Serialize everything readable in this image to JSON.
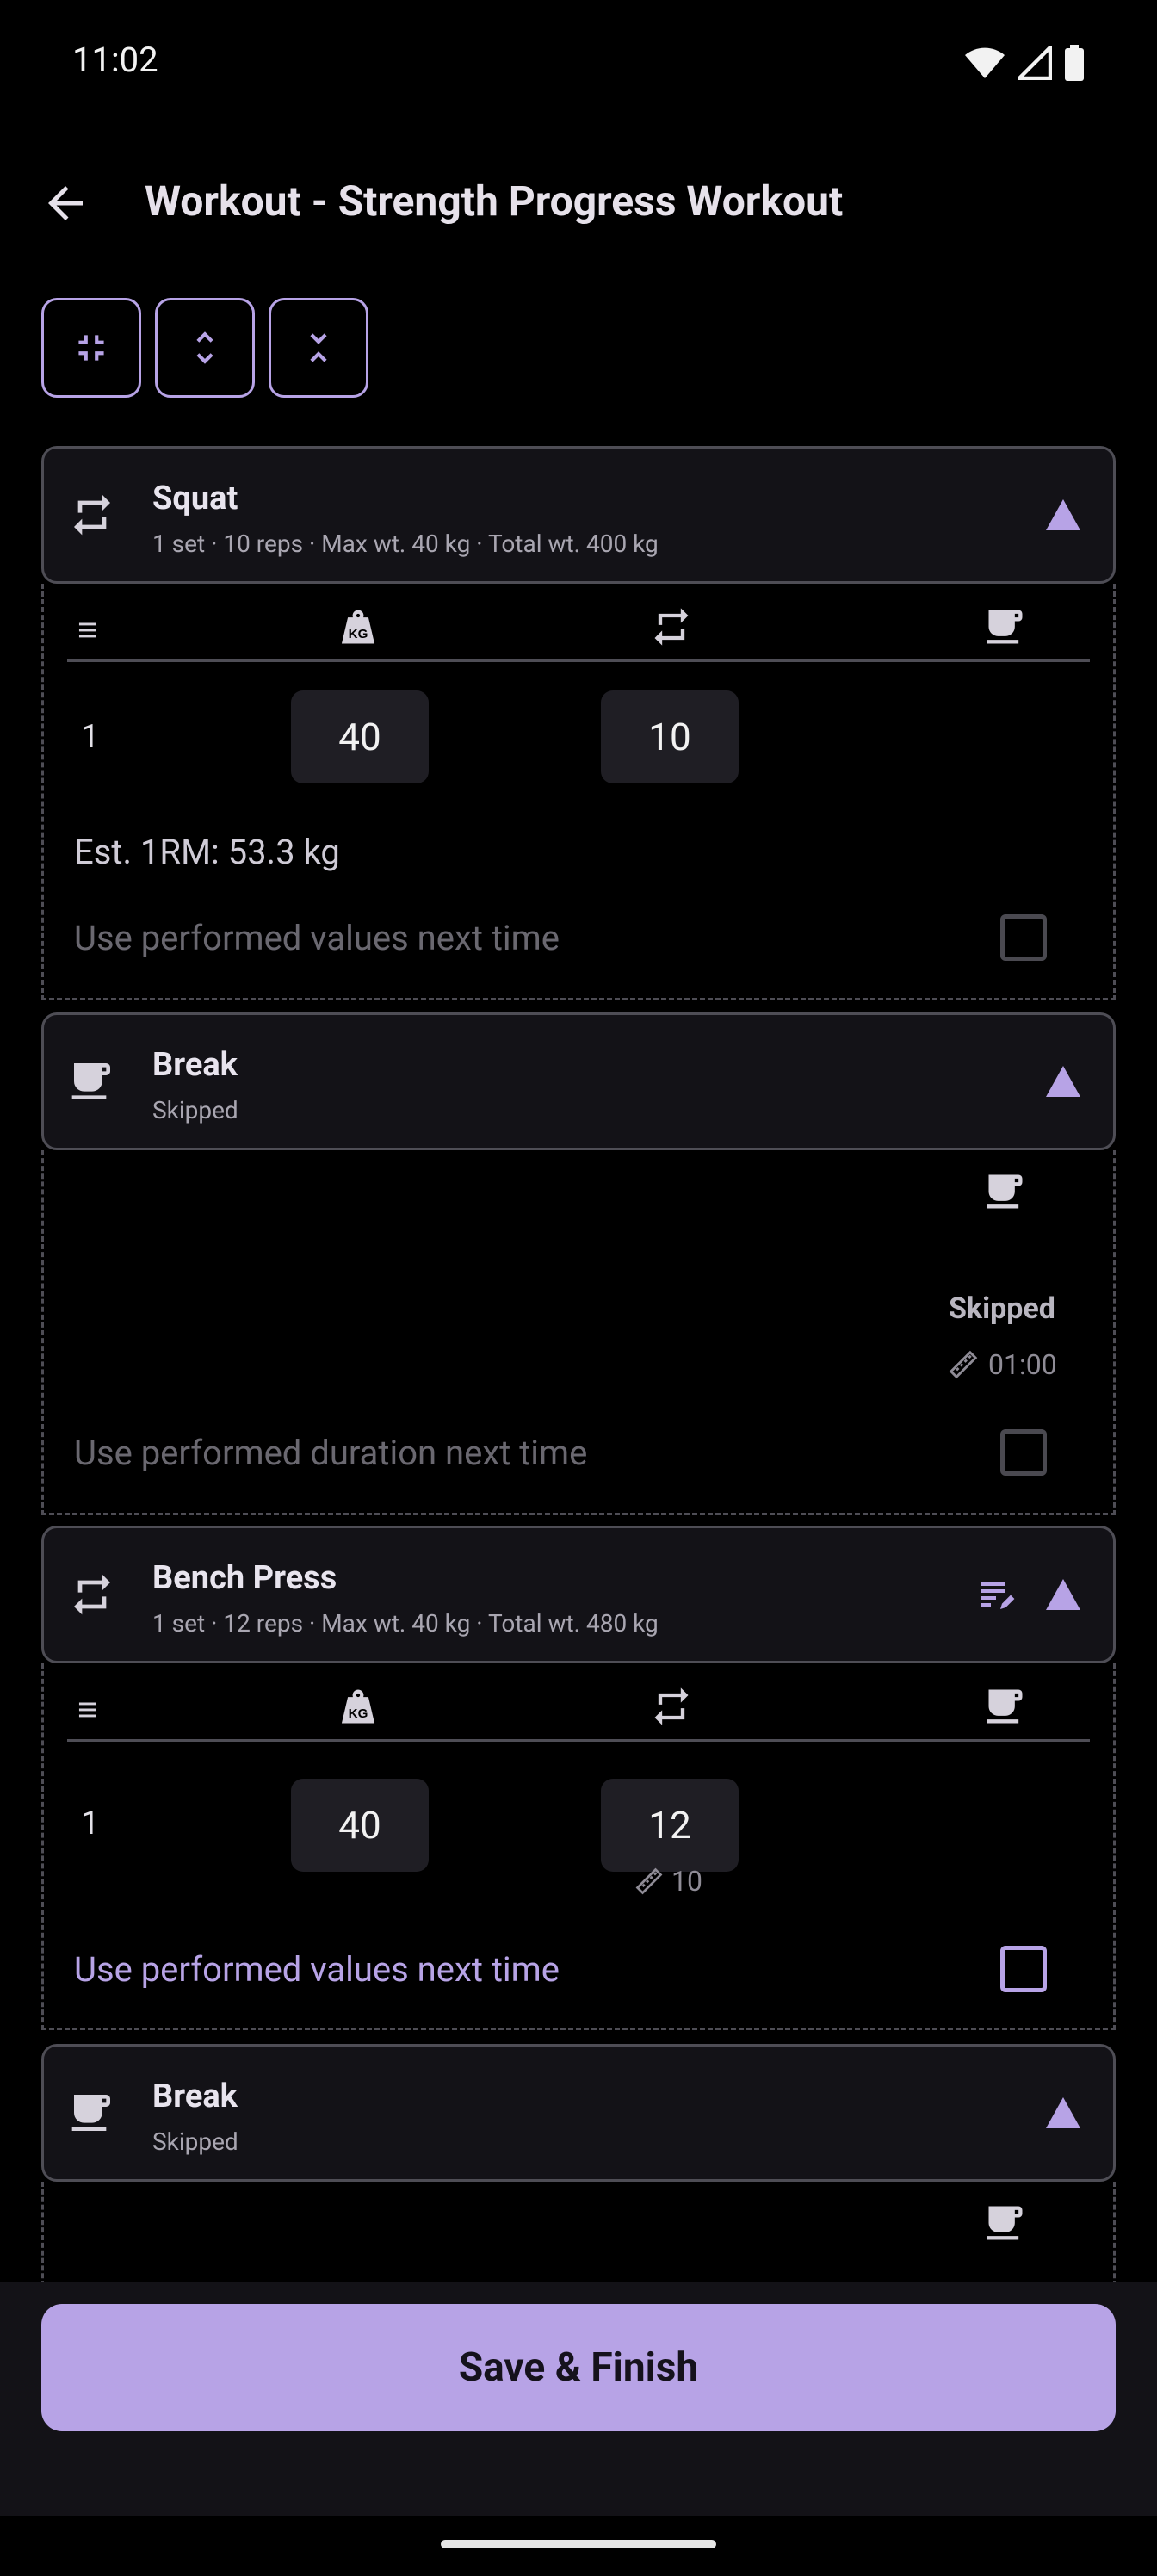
{
  "status_bar": {
    "time": "11:02"
  },
  "app_bar": {
    "title": "Workout - Strength Progress Workout"
  },
  "toolbar": {
    "buttons": [
      "collapse-all",
      "expand-all",
      "collapse-expand"
    ]
  },
  "colors": {
    "accent": "#b7a3e6",
    "background": "#000000",
    "card": "#131217",
    "border": "#4e4d55"
  },
  "exercises": [
    {
      "name": "Squat",
      "summary": "1 set · 10 reps · Max wt. 40 kg · Total wt. 400 kg",
      "sets": [
        {
          "num": "1",
          "weight": "40",
          "reps": "10"
        }
      ],
      "est_1rm": "Est. 1RM: 53.3 kg",
      "use_values_label": "Use performed values next time"
    },
    {
      "name": "Bench Press",
      "summary": "1 set · 12 reps · Max wt. 40 kg · Total wt. 480 kg",
      "sets": [
        {
          "num": "1",
          "weight": "40",
          "reps": "12",
          "prev_reps": "10"
        }
      ],
      "use_values_label": "Use performed values next time"
    }
  ],
  "breaks": [
    {
      "name": "Break",
      "status": "Skipped",
      "status_bold": "Skipped",
      "duration": "01:00",
      "use_duration_label": "Use performed duration next time"
    },
    {
      "name": "Break",
      "status": "Skipped"
    }
  ],
  "footer": {
    "save_label": "Save & Finish"
  }
}
